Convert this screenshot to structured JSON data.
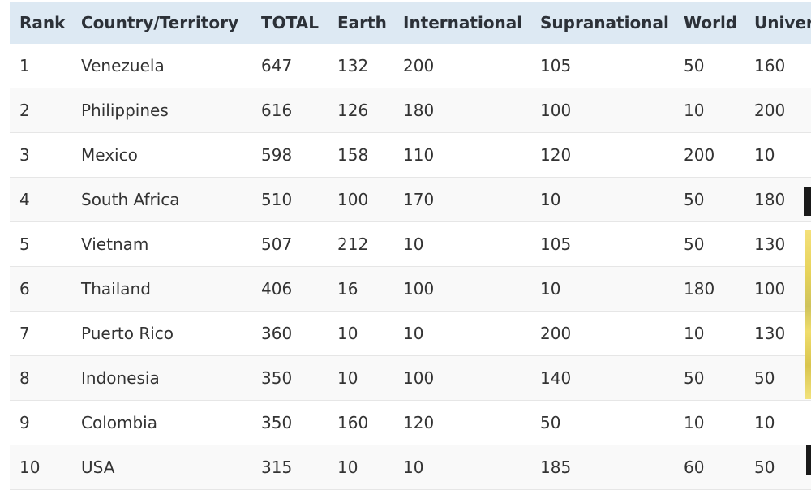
{
  "table": {
    "headers": [
      "Rank",
      "Country/Territory",
      "TOTAL",
      "Earth",
      "International",
      "Supranational",
      "World",
      "Universe"
    ],
    "rows": [
      [
        "1",
        "Venezuela",
        "647",
        "132",
        "200",
        "105",
        "50",
        "160"
      ],
      [
        "2",
        "Philippines",
        "616",
        "126",
        "180",
        "100",
        "10",
        "200"
      ],
      [
        "3",
        "Mexico",
        "598",
        "158",
        "110",
        "120",
        "200",
        "10"
      ],
      [
        "4",
        "South Africa",
        "510",
        "100",
        "170",
        "10",
        "50",
        "180"
      ],
      [
        "5",
        "Vietnam",
        "507",
        "212",
        "10",
        "105",
        "50",
        "130"
      ],
      [
        "6",
        "Thailand",
        "406",
        "16",
        "100",
        "10",
        "180",
        "100"
      ],
      [
        "7",
        "Puerto Rico",
        "360",
        "10",
        "10",
        "200",
        "10",
        "130"
      ],
      [
        "8",
        "Indonesia",
        "350",
        "10",
        "100",
        "140",
        "50",
        "50"
      ],
      [
        "9",
        "Colombia",
        "350",
        "160",
        "120",
        "50",
        "10",
        "10"
      ],
      [
        "10",
        "USA",
        "315",
        "10",
        "10",
        "185",
        "60",
        "50"
      ]
    ]
  },
  "colors": {
    "header_bg": "#dde9f3",
    "row_alt_bg": "#f9f9f9",
    "text": "#333333"
  }
}
